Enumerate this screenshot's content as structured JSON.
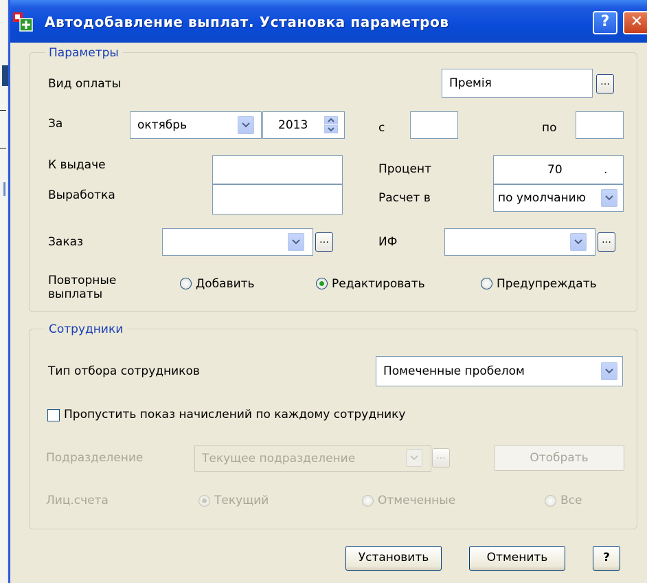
{
  "window": {
    "title": "Автодобавление выплат. Установка параметров",
    "help_label": "?",
    "close_label": "✕"
  },
  "params": {
    "legend": "Параметры",
    "payment_type_label": "Вид оплаты",
    "payment_type_value": "Премія",
    "period_label": "За",
    "month_value": "октябрь",
    "year_value": "2013",
    "from_label": "с",
    "from_value": "",
    "to_label": "по",
    "to_value": "",
    "issue_label": "К выдаче",
    "issue_value": "",
    "output_label": "Выработка",
    "output_value": "",
    "percent_label": "Процент",
    "percent_value": "70",
    "percent_suffix": ".",
    "calc_label": "Расчет в",
    "calc_value": "по умолчанию",
    "order_label": "Заказ",
    "order_value": "",
    "if_label": "ИФ",
    "if_value": "",
    "repeat_label_line1": "Повторные",
    "repeat_label_line2": "выплаты",
    "repeat_options": [
      "Добавить",
      "Редактировать",
      "Предупреждать"
    ],
    "repeat_selected": "Редактировать"
  },
  "employees": {
    "legend": "Сотрудники",
    "selection_type_label": "Тип отбора сотрудников",
    "selection_type_value": "Помеченные пробелом",
    "skip_label": "Пропустить показ начислений по каждому сотруднику",
    "skip_checked": false,
    "department_label": "Подразделение",
    "department_value": "Текущее подразделение",
    "select_button": "Отобрать",
    "accounts_label": "Лиц.счета",
    "accounts_options": [
      "Текущий",
      "Отмеченные",
      "Все"
    ],
    "accounts_selected": "Текущий"
  },
  "footer": {
    "apply_label": "Установить",
    "cancel_label": "Отменить",
    "help_label": "?"
  },
  "colors": {
    "titlebar": "#0a4bd8",
    "dialog_bg": "#ece9d8",
    "legend_text": "#1a3fb7",
    "radio_dot": "#21a121"
  }
}
